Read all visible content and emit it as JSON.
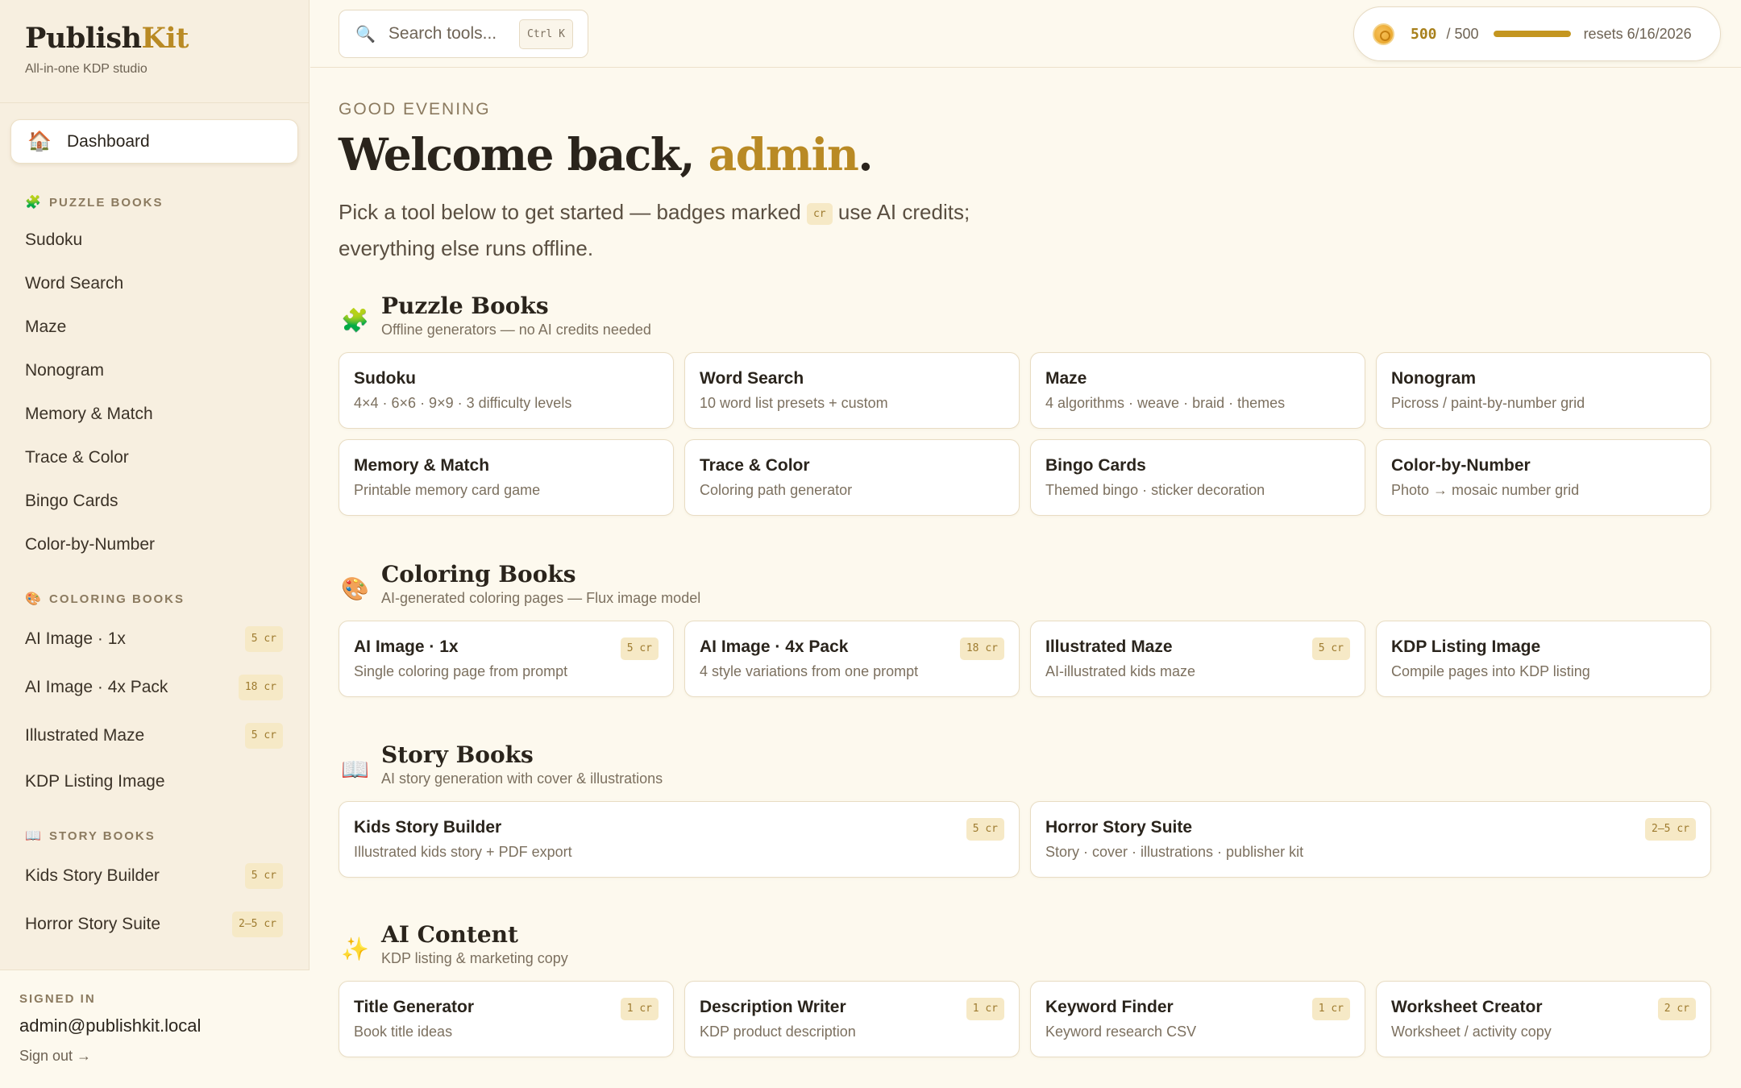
{
  "brand": {
    "name_a": "Publish",
    "name_b": "Kit",
    "tagline": "All-in-one KDP studio"
  },
  "sidebar": {
    "dashboard": {
      "icon": "🏠",
      "label": "Dashboard"
    },
    "groups": [
      {
        "icon": "🧩",
        "title": "PUZZLE BOOKS",
        "items": [
          {
            "label": "Sudoku",
            "badge": ""
          },
          {
            "label": "Word Search",
            "badge": ""
          },
          {
            "label": "Maze",
            "badge": ""
          },
          {
            "label": "Nonogram",
            "badge": ""
          },
          {
            "label": "Memory & Match",
            "badge": ""
          },
          {
            "label": "Trace & Color",
            "badge": ""
          },
          {
            "label": "Bingo Cards",
            "badge": ""
          },
          {
            "label": "Color-by-Number",
            "badge": ""
          }
        ]
      },
      {
        "icon": "🎨",
        "title": "COLORING BOOKS",
        "items": [
          {
            "label": "AI Image · 1x",
            "badge": "5 cr"
          },
          {
            "label": "AI Image · 4x Pack",
            "badge": "18 cr"
          },
          {
            "label": "Illustrated Maze",
            "badge": "5 cr"
          },
          {
            "label": "KDP Listing Image",
            "badge": ""
          }
        ]
      },
      {
        "icon": "📖",
        "title": "STORY BOOKS",
        "items": [
          {
            "label": "Kids Story Builder",
            "badge": "5 cr"
          },
          {
            "label": "Horror Story Suite",
            "badge": "2–5 cr"
          }
        ]
      }
    ],
    "footer": {
      "label": "SIGNED IN",
      "email": "admin@publishkit.local",
      "signout": "Sign out →"
    }
  },
  "search": {
    "placeholder": "Search tools...",
    "shortcut": "Ctrl K"
  },
  "credits": {
    "used": "500",
    "total": "/ 500",
    "fraction": 1.0,
    "reset": "resets 6/16/2026"
  },
  "main": {
    "greeting": "GOOD EVENING",
    "welcome_prefix": "Welcome back, ",
    "welcome_user": "admin",
    "welcome_suffix": ".",
    "intro_a": "Pick a tool below to get started — badges marked ",
    "intro_chip": "cr",
    "intro_b": " use AI credits; everything else runs offline.",
    "sections": [
      {
        "icon": "🧩",
        "title": "Puzzle Books",
        "subtitle": "Offline generators — no AI credits needed",
        "cards": [
          {
            "title": "Sudoku",
            "desc": "4×4 · 6×6 · 9×9 · 3 difficulty levels",
            "badge": ""
          },
          {
            "title": "Word Search",
            "desc": "10 word list presets + custom",
            "badge": ""
          },
          {
            "title": "Maze",
            "desc": "4 algorithms · weave · braid · themes",
            "badge": ""
          },
          {
            "title": "Nonogram",
            "desc": "Picross / paint-by-number grid",
            "badge": ""
          },
          {
            "title": "Memory & Match",
            "desc": "Printable memory card game",
            "badge": ""
          },
          {
            "title": "Trace & Color",
            "desc": "Coloring path generator",
            "badge": ""
          },
          {
            "title": "Bingo Cards",
            "desc": "Themed bingo · sticker decoration",
            "badge": ""
          },
          {
            "title": "Color-by-Number",
            "desc": "Photo → mosaic number grid",
            "badge": ""
          }
        ]
      },
      {
        "icon": "🎨",
        "title": "Coloring Books",
        "subtitle": "AI-generated coloring pages — Flux image model",
        "cards": [
          {
            "title": "AI Image · 1x",
            "desc": "Single coloring page from prompt",
            "badge": "5 cr"
          },
          {
            "title": "AI Image · 4x Pack",
            "desc": "4 style variations from one prompt",
            "badge": "18 cr"
          },
          {
            "title": "Illustrated Maze",
            "desc": "AI-illustrated kids maze",
            "badge": "5 cr"
          },
          {
            "title": "KDP Listing Image",
            "desc": "Compile pages into KDP listing",
            "badge": ""
          }
        ]
      },
      {
        "icon": "📖",
        "title": "Story Books",
        "subtitle": "AI story generation with cover & illustrations",
        "cards": [
          {
            "title": "Kids Story Builder",
            "desc": "Illustrated kids story + PDF export",
            "badge": "5 cr"
          },
          {
            "title": "Horror Story Suite",
            "desc": "Story · cover · illustrations · publisher kit",
            "badge": "2–5 cr"
          }
        ]
      },
      {
        "icon": "✨",
        "title": "AI Content",
        "subtitle": "KDP listing & marketing copy",
        "cards": [
          {
            "title": "Title Generator",
            "desc": "Book title ideas",
            "badge": "1 cr"
          },
          {
            "title": "Description Writer",
            "desc": "KDP product description",
            "badge": "1 cr"
          },
          {
            "title": "Keyword Finder",
            "desc": "Keyword research CSV",
            "badge": "1 cr"
          },
          {
            "title": "Worksheet Creator",
            "desc": "Worksheet / activity copy",
            "badge": "2 cr"
          }
        ]
      }
    ]
  }
}
